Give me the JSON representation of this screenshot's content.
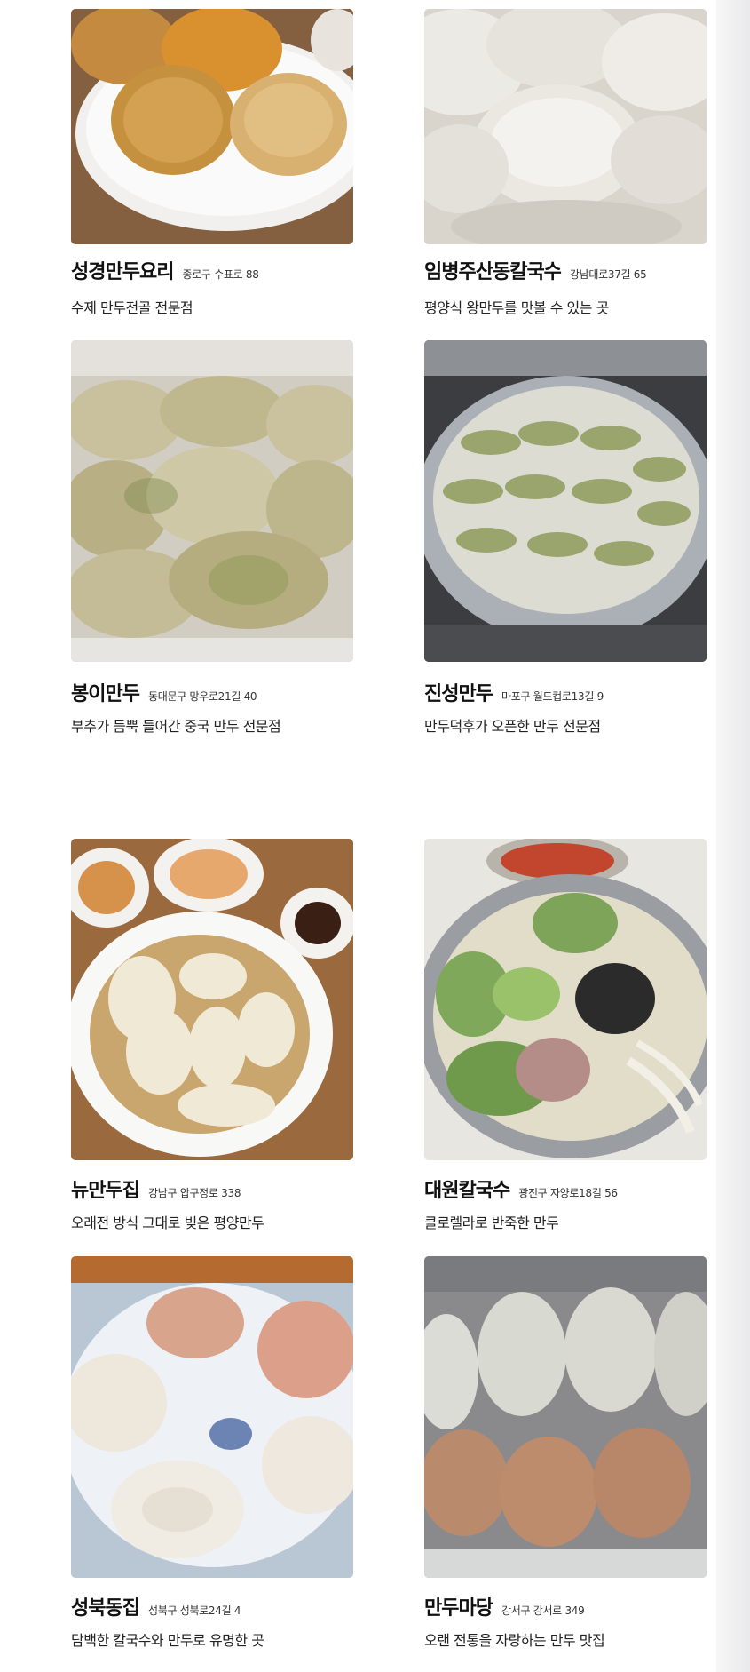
{
  "restaurants": [
    {
      "name": "성경만두요리",
      "address": "종로구 수표로 88",
      "description": "수제 만두전골 전문점",
      "photo": "fried dumplings on white plate"
    },
    {
      "name": "임병주산동칼국수",
      "address": "강남대로37길 65",
      "description": "평양식 왕만두를 맛볼 수 있는 곳",
      "photo": "large steamed white dumplings"
    },
    {
      "name": "봉이만두",
      "address": "동대문구 망우로21길 40",
      "description": "부추가 듬뿍 들어간 중국 만두 전문점",
      "photo": "pile of chive dumplings"
    },
    {
      "name": "진성만두",
      "address": "마포구 월드컵로13길 9",
      "description": "만두덕후가 오픈한 만두 전문점",
      "photo": "dumplings arranged in a steamer"
    },
    {
      "name": "뉴만두집",
      "address": "강남구 압구정로 338",
      "description": "오래전 방식 그대로 빚은 평양만두",
      "photo": "dumpling soup with side dishes"
    },
    {
      "name": "대원칼국수",
      "address": "광진구 자양로18길 56",
      "description": "클로렐라로 반죽한 만두",
      "photo": "green dumplings in noodle soup"
    },
    {
      "name": "성북동집",
      "address": "성북구 성북로24길 4",
      "description": "담백한 칼국수와 만두로 유명한 곳",
      "photo": "pink and white dumplings on plate"
    },
    {
      "name": "만두마당",
      "address": "강서구 강서로 349",
      "description": "오랜 전통을 자랑하는 만두 맛집",
      "photo": "rows of kimchi and vegetable dumplings"
    }
  ],
  "colors": {
    "background": "#ffffff",
    "text": "#111111",
    "subtext": "#333333"
  }
}
